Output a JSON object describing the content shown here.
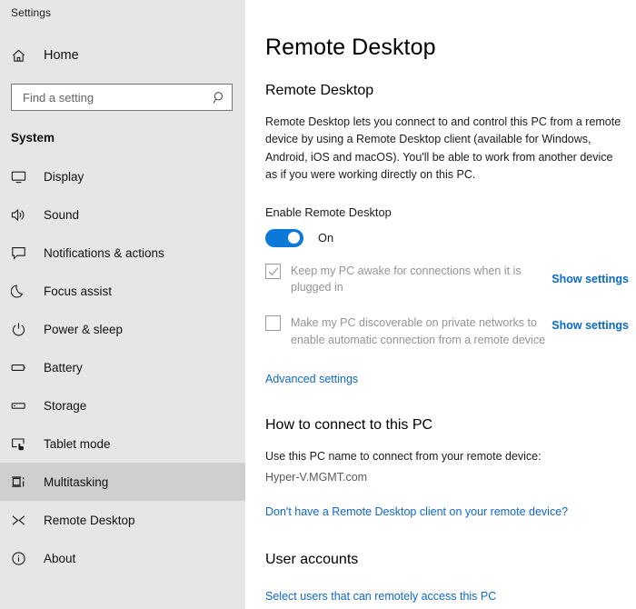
{
  "window": {
    "title": "Settings"
  },
  "sidebar": {
    "home_label": "Home",
    "home_icon": "home-icon",
    "search": {
      "placeholder": "Find a setting",
      "value": "",
      "icon": "search-icon"
    },
    "group_title": "System",
    "items": [
      {
        "label": "Display",
        "icon": "monitor-icon",
        "selected": false
      },
      {
        "label": "Sound",
        "icon": "speaker-icon",
        "selected": false
      },
      {
        "label": "Notifications & actions",
        "icon": "chat-bubble-icon",
        "selected": false
      },
      {
        "label": "Focus assist",
        "icon": "moon-icon",
        "selected": false
      },
      {
        "label": "Power & sleep",
        "icon": "power-icon",
        "selected": false
      },
      {
        "label": "Battery",
        "icon": "battery-icon",
        "selected": false
      },
      {
        "label": "Storage",
        "icon": "storage-icon",
        "selected": false
      },
      {
        "label": "Tablet mode",
        "icon": "tablet-hand-icon",
        "selected": false
      },
      {
        "label": "Multitasking",
        "icon": "multitasking-icon",
        "selected": true
      },
      {
        "label": "Remote Desktop",
        "icon": "remote-desktop-icon",
        "selected": false
      },
      {
        "label": "About",
        "icon": "info-icon",
        "selected": false
      }
    ]
  },
  "main": {
    "page_title": "Remote Desktop",
    "section_remote_desktop": {
      "heading": "Remote Desktop",
      "description": "Remote Desktop lets you connect to and control this PC from a remote device by using a Remote Desktop client (available for Windows, Android, iOS and macOS). You'll be able to work from another device as if you were working directly on this PC.",
      "enable_label": "Enable Remote Desktop",
      "toggle_state": "On",
      "toggle_on": true,
      "checkboxes": [
        {
          "label": "Keep my PC awake for connections when it is plugged in",
          "checked": true,
          "disabled": true,
          "action_label": "Show settings"
        },
        {
          "label": "Make my PC discoverable on private networks to enable automatic connection from a remote device",
          "checked": false,
          "disabled": true,
          "action_label": "Show settings"
        }
      ],
      "advanced_settings_link": "Advanced settings"
    },
    "section_how_to_connect": {
      "heading": "How to connect to this PC",
      "instruction": "Use this PC name to connect from your remote device:",
      "pc_name": "Hyper-V.MGMT.com",
      "client_link": "Don't have a Remote Desktop client on your remote device?"
    },
    "section_user_accounts": {
      "heading": "User accounts",
      "select_users_link": "Select users that can remotely access this PC"
    }
  },
  "colors": {
    "accent": "#0a79d7",
    "link": "#1068c9",
    "sidebar_bg": "#e6e6e6",
    "selected_row": "#cfcfcf",
    "disabled_text": "#949494"
  }
}
